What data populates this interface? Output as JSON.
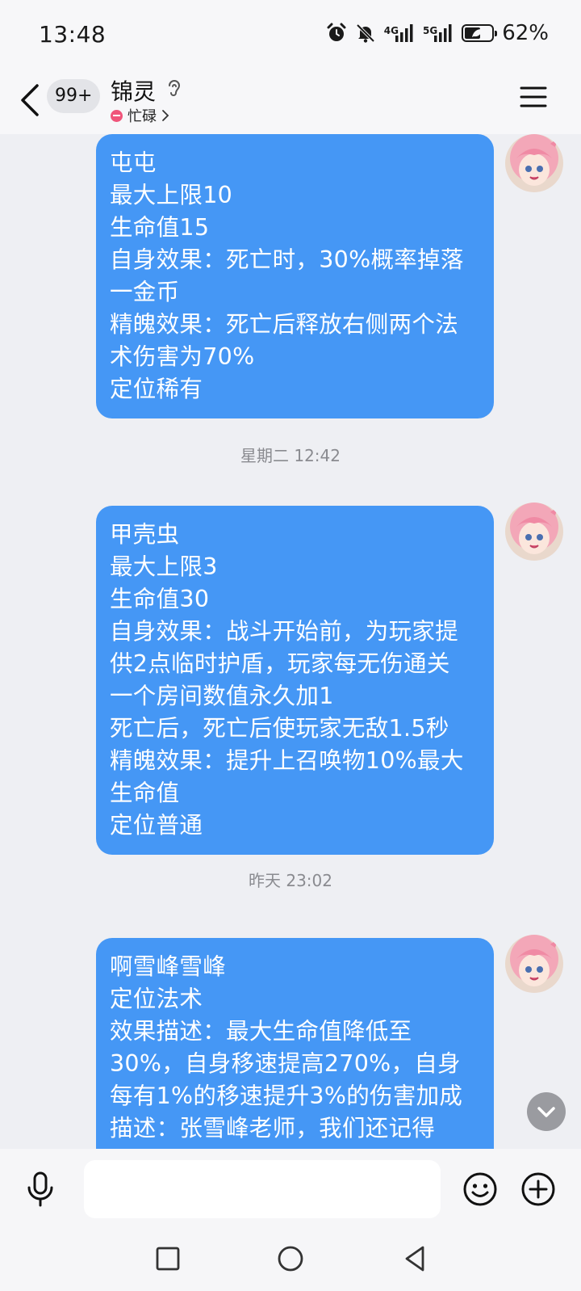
{
  "status_bar": {
    "time": "13:48",
    "network_1": "4G",
    "network_2": "5G",
    "battery_percent": "62%",
    "battery_level": 0.62
  },
  "header": {
    "unread_count": "99+",
    "contact_name": "锦灵",
    "status_text": "忙碌",
    "status_color": "#f0547a"
  },
  "messages": [
    {
      "lines": [
        "屯屯",
        "最大上限10",
        "生命值15",
        "自身效果：死亡时，30%概率掉落",
        "一金币",
        "精魄效果：死亡后释放右侧两个法",
        "术伤害为70%",
        "定位稀有"
      ]
    },
    {
      "timestamp": "星期二 12:42",
      "lines": [
        "甲壳虫",
        "最大上限3",
        "生命值30",
        "自身效果：战斗开始前，为玩家提",
        "供2点临时护盾，玩家每无伤通关",
        "一个房间数值永久加1",
        "死亡后，死亡后使玩家无敌1.5秒",
        "精魄效果：提升上召唤物10%最大",
        "生命值",
        "定位普通"
      ]
    },
    {
      "timestamp": "昨天 23:02",
      "lines": [
        "啊雪峰雪峰",
        "定位法术",
        "效果描述：最大生命值降低至",
        "30%，自身移速提高270%，自身",
        "每有1%的移速提升3%的伤害加成",
        "描述：张雪峰老师，我们还记得"
      ]
    }
  ],
  "input": {
    "value": "",
    "placeholder": ""
  },
  "colors": {
    "bubble": "#4597f5",
    "background": "#eeeff3"
  }
}
